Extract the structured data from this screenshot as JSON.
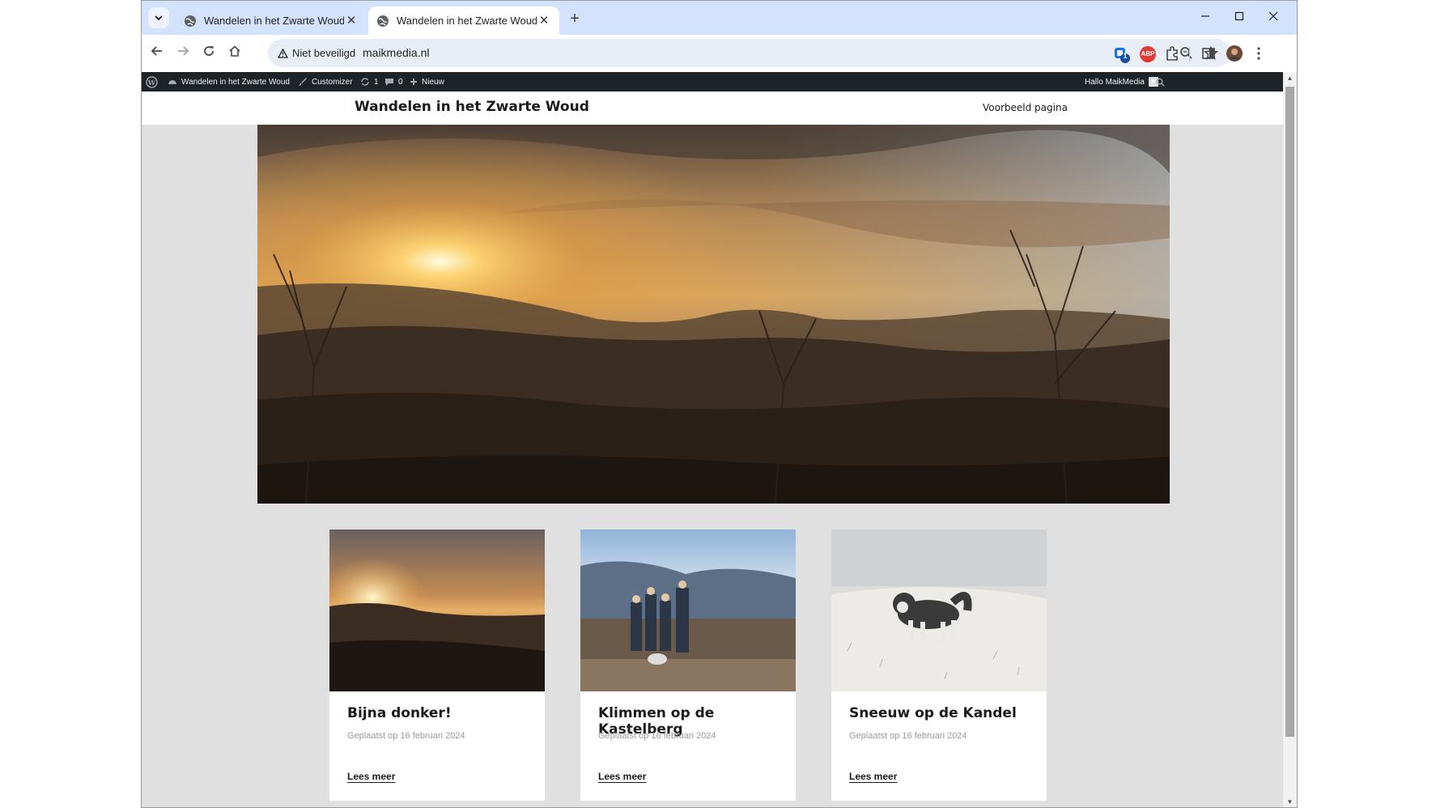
{
  "browser": {
    "tabs": [
      {
        "title": "Wandelen in het Zwarte Woud",
        "active": false
      },
      {
        "title": "Wandelen in het Zwarte Woud",
        "active": true
      }
    ],
    "new_tab_label": "+",
    "security_label": "Niet beveiligd",
    "url": "maikmedia.nl",
    "extension_badge": "1",
    "abp_label": "ABP"
  },
  "adminbar": {
    "site_name": "Wandelen in het Zwarte Woud",
    "customizer": "Customizer",
    "updates_count": "1",
    "comments_count": "0",
    "new_label": "Nieuw",
    "greeting": "Hallo MaikMedia"
  },
  "site": {
    "title": "Wandelen in het Zwarte Woud",
    "menu": [
      "Voorbeeld pagina"
    ]
  },
  "posts": [
    {
      "title": "Bijna donker!",
      "meta": "Geplaatst op 16 februari 2024",
      "more": "Lees meer"
    },
    {
      "title": "Klimmen op de Kastelberg",
      "meta": "Geplaatst op 16 februari 2024",
      "more": "Lees meer"
    },
    {
      "title": "Sneeuw op de Kandel",
      "meta": "Geplaatst op 16 februari 2024",
      "more": "Lees meer"
    }
  ],
  "colors": {
    "tabstrip": "#d3e3fd",
    "adminbar": "#1d2327",
    "page_bg": "#e0e0e0"
  }
}
